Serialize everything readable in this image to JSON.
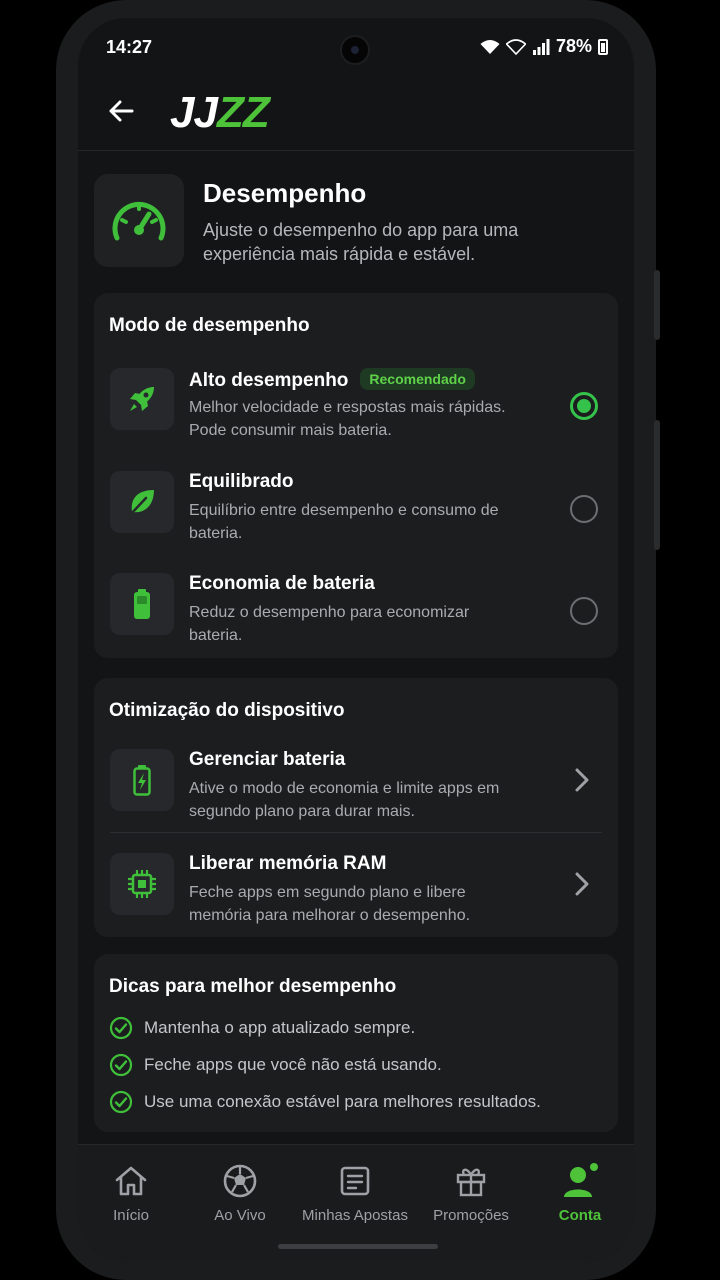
{
  "status": {
    "time": "14:27",
    "battery": "78%"
  },
  "header": {
    "logo_part1": "JJ",
    "logo_part2": "ZZ"
  },
  "page": {
    "title": "Desempenho",
    "subtitle": "Ajuste o desempenho do app para uma experiência mais rápida e estável."
  },
  "performance_mode": {
    "title": "Modo de desempenho",
    "options": [
      {
        "name": "Alto desempenho",
        "badge": "Recomendado",
        "desc": "Melhor velocidade e respostas mais rápidas. Pode consumir mais bateria.",
        "icon": "rocket-icon",
        "selected": true
      },
      {
        "name": "Equilibrado",
        "desc": "Equilíbrio entre desempenho e consumo de bateria.",
        "icon": "leaf-icon",
        "selected": false
      },
      {
        "name": "Economia de bateria",
        "desc": "Reduz o desempenho para economizar bateria.",
        "icon": "battery-icon",
        "selected": false
      }
    ]
  },
  "optimization": {
    "title": "Otimização do dispositivo",
    "items": [
      {
        "name": "Gerenciar bateria",
        "desc": "Ative o modo de economia e limite apps em segundo plano para durar mais.",
        "icon": "battery-charging-icon"
      },
      {
        "name": "Liberar memória RAM",
        "desc": "Feche apps em segundo plano e libere memória para melhorar o desempenho.",
        "icon": "chip-icon"
      }
    ]
  },
  "tips": {
    "title": "Dicas para melhor desempenho",
    "items": [
      "Mantenha o app atualizado sempre.",
      "Feche apps que você não está usando.",
      "Use uma conexão estável para melhores resultados."
    ]
  },
  "nav": {
    "items": [
      {
        "label": "Início",
        "icon": "home-icon"
      },
      {
        "label": "Ao Vivo",
        "icon": "soccer-ball-icon"
      },
      {
        "label": "Minhas Apostas",
        "icon": "ticket-icon"
      },
      {
        "label": "Promoções",
        "icon": "gift-icon"
      },
      {
        "label": "Conta",
        "icon": "user-icon",
        "active": true
      }
    ]
  },
  "colors": {
    "accent": "#4ec33a",
    "radio_on": "#35c24a",
    "background": "#131416",
    "card": "#1c1d1f"
  }
}
